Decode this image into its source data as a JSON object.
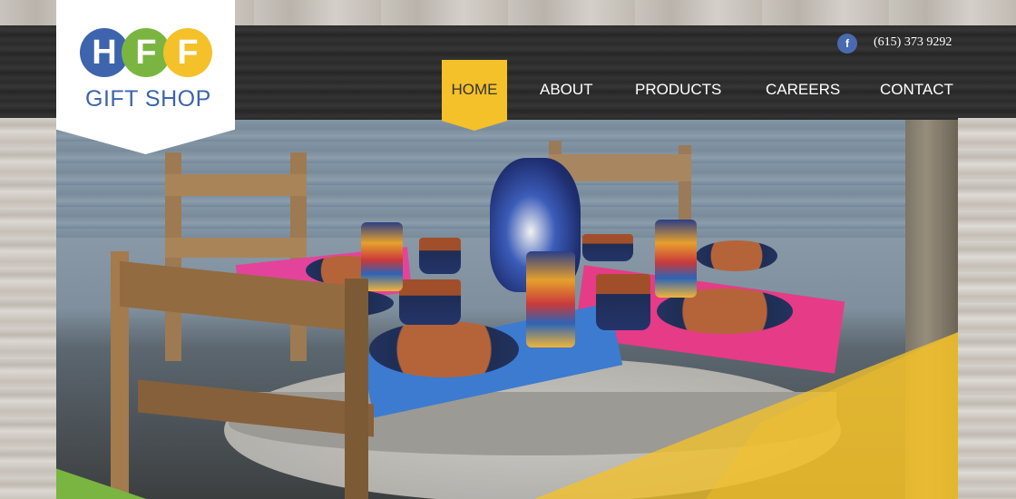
{
  "logo": {
    "letters": [
      "H",
      "F",
      "F"
    ],
    "subtitle": "GIFT SHOP"
  },
  "header": {
    "facebook_icon_label": "f",
    "phone": "(615) 373 9292"
  },
  "nav": {
    "items": [
      {
        "label": "HOME",
        "active": true
      },
      {
        "label": "ABOUT",
        "active": false
      },
      {
        "label": "PRODUCTS",
        "active": false
      },
      {
        "label": "CAREERS",
        "active": false
      },
      {
        "label": "CONTACT",
        "active": false
      }
    ]
  },
  "colors": {
    "brand_blue": "#3d64ac",
    "brand_green": "#7ab541",
    "brand_yellow": "#f4c12a",
    "header_dark": "#2d2d2d"
  }
}
